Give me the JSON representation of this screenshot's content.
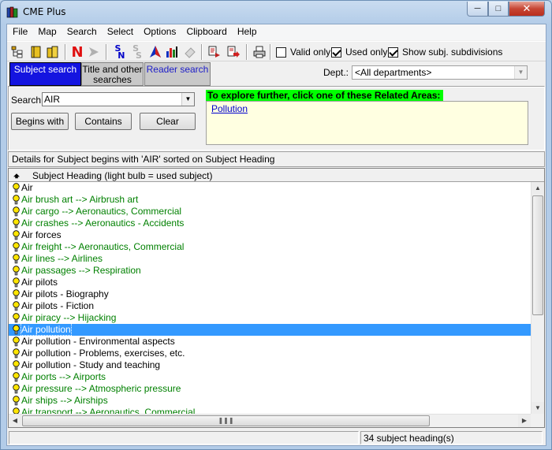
{
  "window": {
    "title": "CME Plus"
  },
  "menu": [
    "File",
    "Map",
    "Search",
    "Select",
    "Options",
    "Clipboard",
    "Help"
  ],
  "toolbar": {
    "valid_only": {
      "label": "Valid only",
      "checked": false
    },
    "used_only": {
      "label": "Used only",
      "checked": true
    },
    "show_subdivisions": {
      "label": "Show subj. subdivisions",
      "checked": true
    }
  },
  "tabs": {
    "subject": "Subject search",
    "title": "Title and other searches",
    "reader": "Reader search"
  },
  "dept": {
    "label": "Dept.:",
    "value": "<All departments>"
  },
  "search": {
    "label": "Search:",
    "value": "AIR",
    "begins_with": "Begins with",
    "contains": "Contains",
    "clear": "Clear"
  },
  "related": {
    "title": "To explore further, click one of these Related Areas:",
    "links": [
      "Pollution"
    ]
  },
  "details": "Details for Subject begins with 'AIR' sorted on Subject Heading",
  "grid": {
    "header": "Subject Heading   (light bulb = used subject)",
    "rows": [
      {
        "text": "Air",
        "green": false
      },
      {
        "text": "Air brush art --> Airbrush art",
        "green": true
      },
      {
        "text": "Air cargo --> Aeronautics, Commercial",
        "green": true
      },
      {
        "text": "Air crashes --> Aeronautics - Accidents",
        "green": true
      },
      {
        "text": "Air forces",
        "green": false
      },
      {
        "text": "Air freight --> Aeronautics, Commercial",
        "green": true
      },
      {
        "text": "Air lines --> Airlines",
        "green": true
      },
      {
        "text": "Air passages --> Respiration",
        "green": true
      },
      {
        "text": "Air pilots",
        "green": false
      },
      {
        "text": "Air pilots - Biography",
        "green": false
      },
      {
        "text": "Air pilots - Fiction",
        "green": false
      },
      {
        "text": "Air piracy --> Hijacking",
        "green": true
      },
      {
        "text": "Air pollution",
        "green": false,
        "selected": true
      },
      {
        "text": "Air pollution - Environmental aspects",
        "green": false
      },
      {
        "text": "Air pollution - Problems, exercises, etc.",
        "green": false
      },
      {
        "text": "Air pollution - Study and teaching",
        "green": false
      },
      {
        "text": "Air ports --> Airports",
        "green": true
      },
      {
        "text": "Air pressure --> Atmospheric pressure",
        "green": true
      },
      {
        "text": "Air ships --> Airships",
        "green": true
      },
      {
        "text": "Air transport --> Aeronautics, Commercial",
        "green": true
      }
    ]
  },
  "status": {
    "left": "",
    "count": "34 subject heading(s)"
  }
}
